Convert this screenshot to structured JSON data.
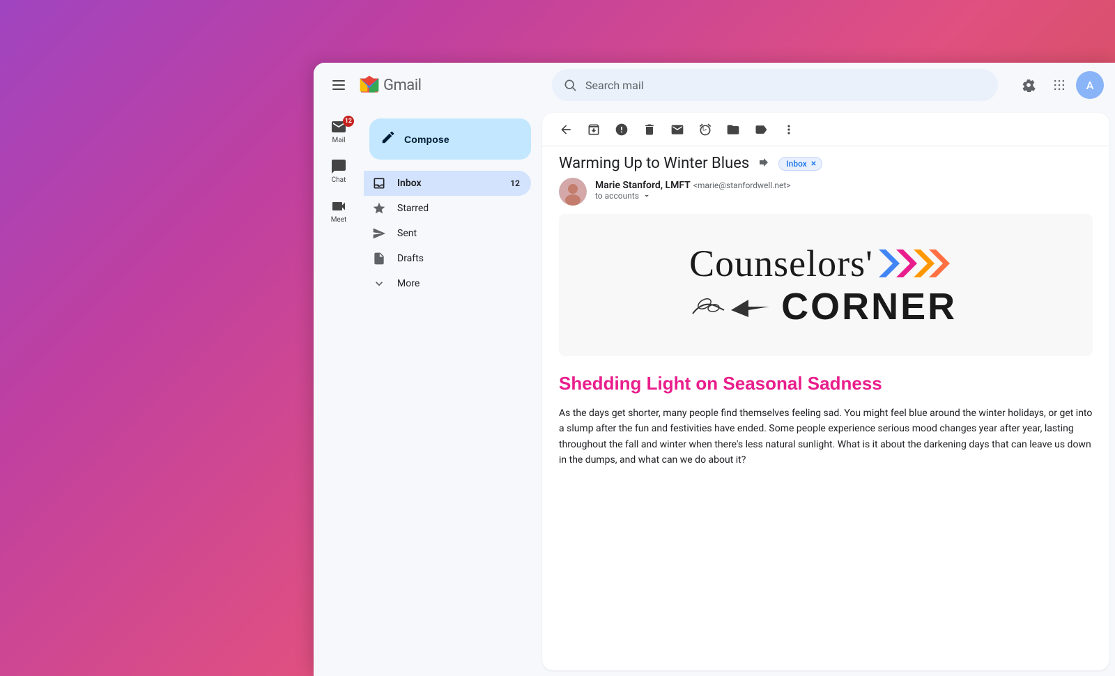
{
  "background": {
    "gradient": "linear-gradient(135deg, #a044c0, #c040a0, #e05080, #d05050)"
  },
  "header": {
    "gmail_label": "Gmail",
    "search_placeholder": "Search mail",
    "settings_label": "Settings",
    "apps_label": "Google apps"
  },
  "icon_sidebar": {
    "items": [
      {
        "id": "mail",
        "label": "Mail",
        "icon": "✉",
        "badge": "12"
      },
      {
        "id": "chat",
        "label": "Chat",
        "icon": "💬",
        "badge": null
      },
      {
        "id": "meet",
        "label": "Meet",
        "icon": "📹",
        "badge": null
      }
    ]
  },
  "nav_sidebar": {
    "compose_label": "Compose",
    "items": [
      {
        "id": "inbox",
        "label": "Inbox",
        "icon": "inbox",
        "count": "12",
        "active": true
      },
      {
        "id": "starred",
        "label": "Starred",
        "icon": "star",
        "count": null,
        "active": false
      },
      {
        "id": "sent",
        "label": "Sent",
        "icon": "send",
        "count": null,
        "active": false
      },
      {
        "id": "drafts",
        "label": "Drafts",
        "icon": "draft",
        "count": null,
        "active": false
      },
      {
        "id": "more",
        "label": "More",
        "icon": "expand",
        "count": null,
        "active": false
      }
    ]
  },
  "email": {
    "subject": "Warming Up to Winter Blues",
    "inbox_badge": "Inbox",
    "sender_name": "Marie Stanford, LMFT",
    "sender_email": "marie@stanfordwell.net",
    "sender_to": "to accounts",
    "newsletter_top": "Counselors'",
    "newsletter_bottom": "Corner",
    "article_heading": "Shedding Light on Seasonal Sadness",
    "article_body": "As the days get shorter, many people find themselves feeling sad. You might feel blue around the winter holidays, or get into a slump after the fun and festivities have ended. Some people experience serious mood changes year after year, lasting throughout the fall and winter when there's less natural sunlight. What is it about the darkening days that can leave us down in the dumps, and what can we do about it?"
  },
  "toolbar": {
    "back_label": "Back",
    "archive_label": "Archive",
    "report_spam_label": "Report spam",
    "delete_label": "Delete",
    "mark_unread_label": "Mark as unread",
    "snooze_label": "Snooze",
    "move_label": "Move to",
    "labels_label": "Labels",
    "more_label": "More"
  }
}
